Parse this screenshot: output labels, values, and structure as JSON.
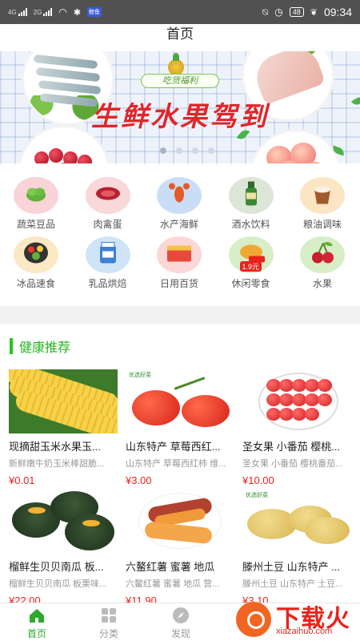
{
  "status_bar": {
    "signal_1": "4G",
    "signal_2": "2G",
    "app_badge": "鲸鱼",
    "battery": "48",
    "time": "09:34"
  },
  "header": {
    "title": "首页"
  },
  "banner": {
    "ribbon": "吃货福利",
    "headline": "生鲜水果驾到",
    "page_count": 4,
    "active_page": 1
  },
  "categories": [
    {
      "label": "蔬菜豆品",
      "icon": "vegetable-icon",
      "color": "#f8d3d7"
    },
    {
      "label": "肉禽蛋",
      "icon": "meat-icon",
      "color": "#f8d8d8"
    },
    {
      "label": "水产海鲜",
      "icon": "lobster-icon",
      "color": "#c9def6"
    },
    {
      "label": "酒水饮料",
      "icon": "beer-icon",
      "color": "#dde5d7"
    },
    {
      "label": "粮油调味",
      "icon": "rice-jar-icon",
      "color": "#fbe6c4"
    },
    {
      "label": "冰品速食",
      "icon": "lunchbox-icon",
      "color": "#fbe8c4"
    },
    {
      "label": "乳品烘焙",
      "icon": "milk-icon",
      "color": "#cfe4f7"
    },
    {
      "label": "日用百货",
      "icon": "box-icon",
      "color": "#fbd7d7"
    },
    {
      "label": "休闲零食",
      "icon": "snack-icon",
      "color": "#d7eec7",
      "badge": "1.9元"
    },
    {
      "label": "水果",
      "icon": "cherry-icon",
      "color": "#d7eec7"
    }
  ],
  "section": {
    "title": "健康推荐"
  },
  "products": [
    {
      "name": "现摘甜玉米水果玉...",
      "desc": "新鲜嫩牛奶玉米棒甜脆...",
      "price": "¥0.01",
      "image": "corn"
    },
    {
      "name": "山东特产 草莓西红...",
      "desc": "山东特产 草莓西红柿 维...",
      "price": "¥3.00",
      "image": "tomato"
    },
    {
      "name": "圣女果 小番茄 樱桃...",
      "desc": "圣女果 小番茄 樱桃番茄...",
      "price": "¥10.00",
      "image": "cherry-tomato"
    },
    {
      "name": "榴鲜生贝贝南瓜 板...",
      "desc": "榴鲜生贝贝南瓜 板栗味...",
      "price": "¥22.00",
      "image": "pumpkin"
    },
    {
      "name": "六鳌红薯 蜜薯 地瓜",
      "desc": "六鳌红薯 蜜薯 地瓜 营...",
      "price": "¥11.90",
      "image": "sweet-potato"
    },
    {
      "name": "滕州土豆 山东特产 ...",
      "desc": "滕州土豆 山东特产 土豆...",
      "price": "¥3.10",
      "image": "potato"
    }
  ],
  "tabs": [
    {
      "label": "首页",
      "active": true
    },
    {
      "label": "分类",
      "active": false
    },
    {
      "label": "发现",
      "active": false
    }
  ],
  "watermark": {
    "text": "下载火",
    "url": "xiazaihuo.com"
  }
}
